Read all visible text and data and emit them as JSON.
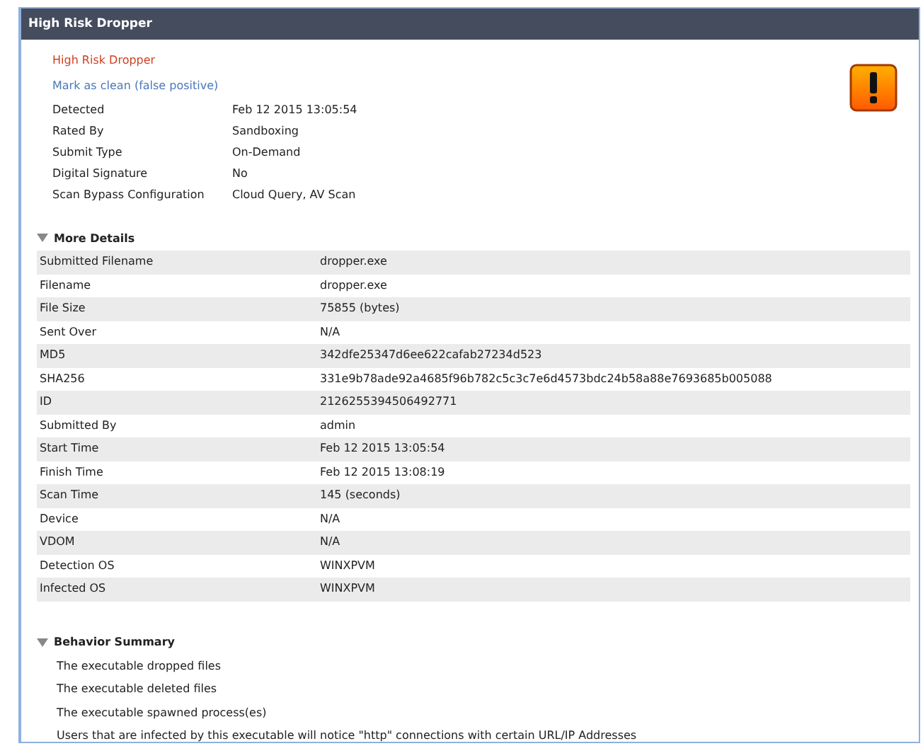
{
  "window": {
    "title": "High Risk Dropper"
  },
  "verdict": "High Risk Dropper",
  "mark_clean_link": "Mark as clean (false positive)",
  "summary": [
    {
      "label": "Detected",
      "value": "Feb 12 2015 13:05:54"
    },
    {
      "label": "Rated By",
      "value": "Sandboxing"
    },
    {
      "label": "Submit Type",
      "value": "On-Demand"
    },
    {
      "label": "Digital Signature",
      "value": "No"
    },
    {
      "label": "Scan Bypass Configuration",
      "value": "Cloud Query, AV Scan"
    }
  ],
  "more_details": {
    "title": "More Details",
    "expanded": true,
    "rows": [
      {
        "label": "Submitted Filename",
        "value": "dropper.exe"
      },
      {
        "label": "Filename",
        "value": "dropper.exe"
      },
      {
        "label": "File Size",
        "value": "75855 (bytes)"
      },
      {
        "label": "Sent Over",
        "value": "N/A"
      },
      {
        "label": "MD5",
        "value": "342dfe25347d6ee622cafab27234d523"
      },
      {
        "label": "SHA256",
        "value": "331e9b78ade92a4685f96b782c5c3c7e6d4573bdc24b58a88e7693685b005088"
      },
      {
        "label": "ID",
        "value": "2126255394506492771"
      },
      {
        "label": "Submitted By",
        "value": "admin"
      },
      {
        "label": "Start Time",
        "value": "Feb 12 2015 13:05:54"
      },
      {
        "label": "Finish Time",
        "value": "Feb 12 2015 13:08:19"
      },
      {
        "label": "Scan Time",
        "value": "145 (seconds)"
      },
      {
        "label": "Device",
        "value": "N/A"
      },
      {
        "label": "VDOM",
        "value": "N/A"
      },
      {
        "label": "Detection OS",
        "value": "WINXPVM"
      },
      {
        "label": "Infected OS",
        "value": "WINXPVM"
      }
    ]
  },
  "behavior_summary": {
    "title": "Behavior Summary",
    "expanded": true,
    "items": [
      "The executable dropped files",
      "The executable deleted files",
      "The executable spawned process(es)",
      "Users that are infected by this executable will notice \"http\" connections with certain URL/IP Addresses"
    ]
  }
}
